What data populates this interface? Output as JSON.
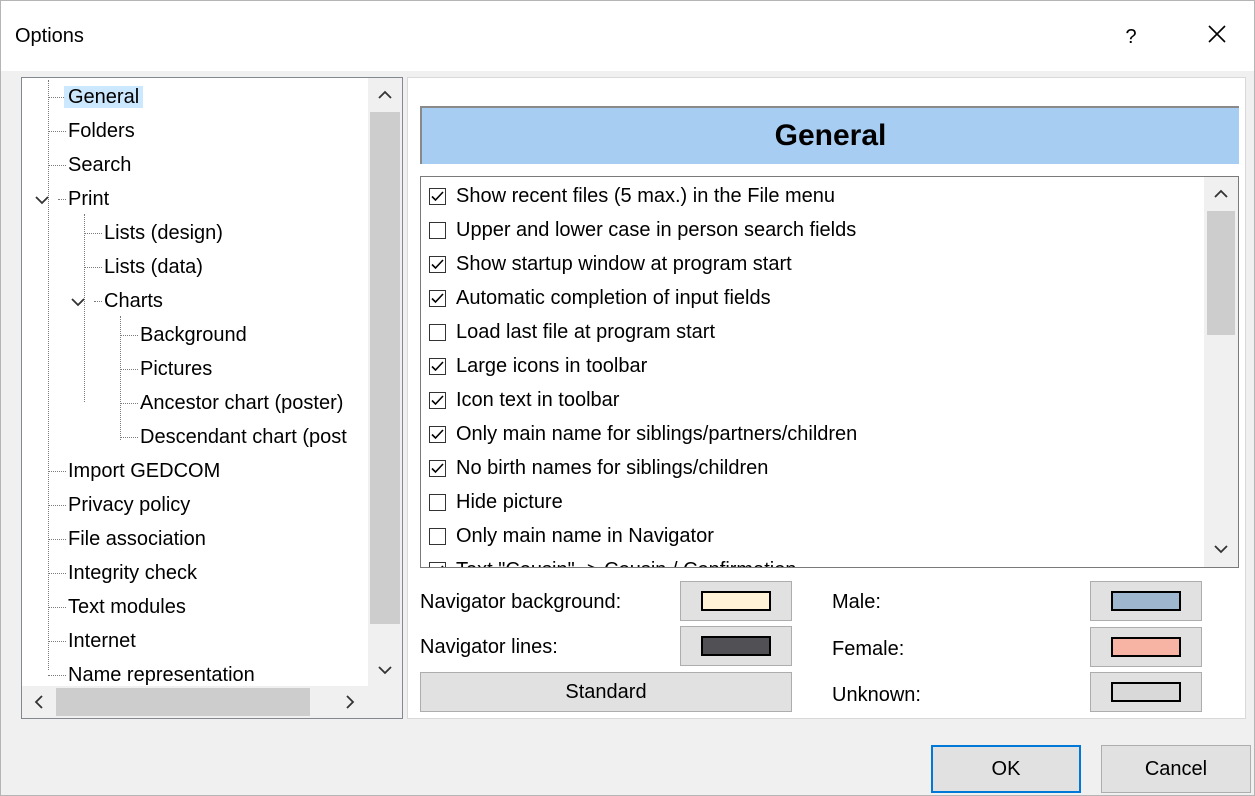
{
  "window": {
    "title": "Options",
    "help_label": "?"
  },
  "tree": {
    "items": [
      {
        "label": "General"
      },
      {
        "label": "Folders"
      },
      {
        "label": "Search"
      },
      {
        "label": "Print"
      },
      {
        "label": "Lists (design)"
      },
      {
        "label": "Lists (data)"
      },
      {
        "label": "Charts"
      },
      {
        "label": "Background"
      },
      {
        "label": "Pictures"
      },
      {
        "label": "Ancestor chart (poster)"
      },
      {
        "label": "Descendant chart (post"
      },
      {
        "label": "Import GEDCOM"
      },
      {
        "label": "Privacy policy"
      },
      {
        "label": "File association"
      },
      {
        "label": "Integrity check"
      },
      {
        "label": "Text modules"
      },
      {
        "label": "Internet"
      },
      {
        "label": "Name representation"
      }
    ]
  },
  "general": {
    "header": "General",
    "options": [
      {
        "label": "Show recent files (5 max.) in the File menu",
        "checked": true
      },
      {
        "label": "Upper and lower case in person search fields",
        "checked": false
      },
      {
        "label": "Show startup window at program start",
        "checked": true
      },
      {
        "label": "Automatic completion of input fields",
        "checked": true
      },
      {
        "label": "Load last file at program start",
        "checked": false
      },
      {
        "label": "Large icons in toolbar",
        "checked": true
      },
      {
        "label": "Icon text in toolbar",
        "checked": true
      },
      {
        "label": "Only main name for siblings/partners/children",
        "checked": true
      },
      {
        "label": "No birth names for siblings/children",
        "checked": true
      },
      {
        "label": "Hide picture",
        "checked": false
      },
      {
        "label": "Only main name in Navigator",
        "checked": false
      },
      {
        "label": "Text \"Cousin\" -> Cousin / Confirmation",
        "checked": true
      }
    ],
    "colors": {
      "navigator_background_label": "Navigator background:",
      "navigator_background": "#fff2d6",
      "navigator_lines_label": "Navigator lines:",
      "navigator_lines": "#505055",
      "male_label": "Male:",
      "male": "#9fb6cf",
      "female_label": "Female:",
      "female": "#f7b3a3",
      "unknown_label": "Unknown:",
      "unknown": "#d9d9d9"
    },
    "standard_label": "Standard"
  },
  "buttons": {
    "ok": "OK",
    "cancel": "Cancel"
  },
  "theme": {
    "selection": "#cce8ff",
    "header_bg": "#a8cdf2",
    "focus": "#0078d7"
  }
}
